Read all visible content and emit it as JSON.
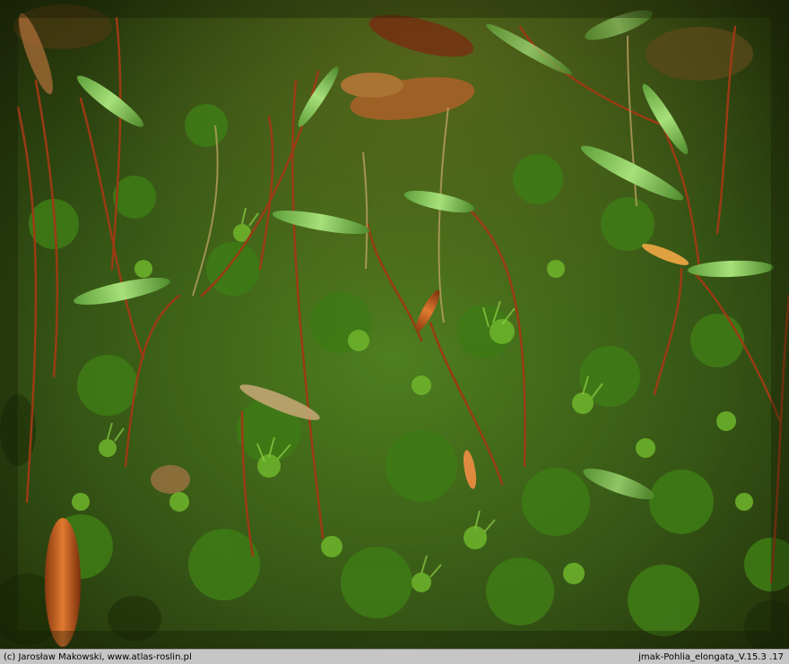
{
  "photo": {
    "subject": "moss-capsules-on-setae",
    "colors": {
      "moss_green": "#4e8a1e",
      "bright_green": "#7fbf3a",
      "seta_red": "#9a3b14",
      "capsule_green": "#8fd06a",
      "dark_bg": "#1e2608",
      "litter_orange": "#c4692a"
    }
  },
  "footer": {
    "credit": "(c) Jarosław Makowski, www.atlas-roslin.pl",
    "filename": "jmak-Pohlia_elongata_V.15.3 .17"
  }
}
